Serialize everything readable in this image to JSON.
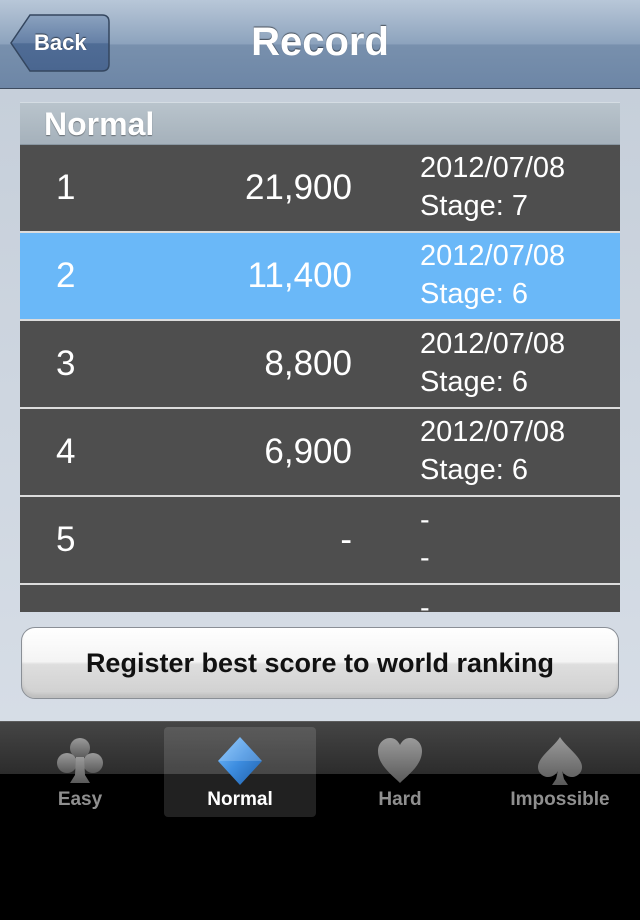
{
  "nav": {
    "title": "Record",
    "back_label": "Back"
  },
  "section": {
    "header": "Normal"
  },
  "records": [
    {
      "rank": "1",
      "score": "21,900",
      "date": "2012/07/08",
      "stage": "Stage: 7",
      "selected": false
    },
    {
      "rank": "2",
      "score": "11,400",
      "date": "2012/07/08",
      "stage": "Stage: 6",
      "selected": true
    },
    {
      "rank": "3",
      "score": "8,800",
      "date": "2012/07/08",
      "stage": "Stage: 6",
      "selected": false
    },
    {
      "rank": "4",
      "score": "6,900",
      "date": "2012/07/08",
      "stage": "Stage: 6",
      "selected": false
    },
    {
      "rank": "5",
      "score": "-",
      "date": "-",
      "stage": "-",
      "selected": false
    },
    {
      "rank": "",
      "score": "",
      "date": "-",
      "stage": "",
      "selected": false
    }
  ],
  "register_button": {
    "label": "Register best score to world ranking"
  },
  "tabs": [
    {
      "label": "Easy",
      "icon": "club-icon",
      "selected": false
    },
    {
      "label": "Normal",
      "icon": "diamond-icon",
      "selected": true
    },
    {
      "label": "Hard",
      "icon": "heart-icon",
      "selected": false
    },
    {
      "label": "Impossible",
      "icon": "spade-icon",
      "selected": false
    }
  ],
  "colors": {
    "selected_row": "#6ab8f8",
    "row_background": "#4e4e4e",
    "tab_active_icon": "#3d8de0"
  }
}
